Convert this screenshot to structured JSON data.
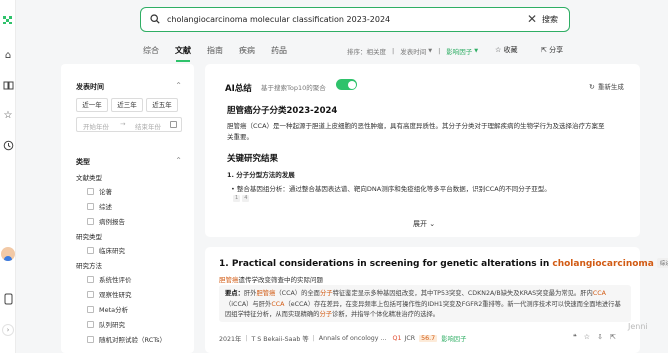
{
  "search": {
    "query": "cholangiocarcinoma molecular classification 2023-2024",
    "button": "搜索"
  },
  "tabs": [
    "综合",
    "文献",
    "指南",
    "疾病",
    "药品"
  ],
  "sort": {
    "label": "排序：",
    "options": [
      "相关度",
      "发表时间",
      "影响因子"
    ]
  },
  "header_actions": {
    "favorite": "收藏",
    "share": "分享"
  },
  "filters": {
    "time_title": "发表时间",
    "time_ranges": [
      "近一年",
      "近三年",
      "近五年"
    ],
    "date_start": "开始年份",
    "date_end": "结束年份",
    "type_title": "类型",
    "literature_type_title": "文献类型",
    "literature_types": [
      "论著",
      "综述",
      "病例报告"
    ],
    "study_type_title": "研究类型",
    "study_types": [
      "临床研究"
    ],
    "method_title": "研究方法",
    "methods": [
      "系统性评价",
      "观察性研究",
      "Meta分析",
      "队列研究",
      "随机对照试验（RCTs）"
    ]
  },
  "ai_summary": {
    "title": "AI总结",
    "note": "基于搜索Top10的聚合",
    "regenerate": "重新生成",
    "heading": "胆管癌分子分类2023-2024",
    "intro": "胆管癌（CCA）是一种起源于胆道上皮细胞的恶性肿瘤，具有高度异质性。其分子分类对于理解疾病的生物学行为及选择治疗方案至关重要。",
    "findings_title": "关键研究结果",
    "point_title": "1. 分子分型方法的发展",
    "point_text": "整合基因组分析：通过整合基因表达谱、靶向DNA测序和免疫组化等多平台数据，识别CCA的不同分子亚型。",
    "refs": [
      "1",
      "4"
    ],
    "expand": "展开"
  },
  "result": {
    "title_prefix": "1. Practical considerations in screening for genetic alterations in ",
    "title_highlight": "cholangiocarcinoma",
    "badge": "综述",
    "subtitle_highlight": "胆管癌",
    "subtitle_rest": "遗传学改变筛查中的实际问题",
    "abstract_label": "要点：",
    "abstract_pre": "肝外",
    "abstract_hl1": "胆管癌",
    "abstract_mid1": "（CCA）的全面",
    "abstract_hl2": "分子",
    "abstract_mid2": "特征鉴定显示多种基因组改变，其中TP53突变、CDKN2A/B缺失及KRAS突变最为常见。肝内",
    "abstract_hl3": "CCA",
    "abstract_mid3": "（iCCA）与肝外",
    "abstract_hl4": "CCA",
    "abstract_mid4": "（eCCA）存在差异，在变异频率上包括可操作性的IDH1突变及FGFR2重排等。新一代测序技术可以快速而全面地进行基因组学特征分析，从而实现精确的",
    "abstract_hl5": "分子",
    "abstract_end": "诊断，并指导个体化精准治疗的选择。",
    "year": "2021年",
    "authors": "T S Bekaii-Saab 等",
    "journal": "Annals of oncology ...",
    "quartile": "Q1",
    "jcr": "JCR",
    "impact": "56.7",
    "impact_label": "影响因子"
  },
  "watermark": "Jenni",
  "colors": {
    "accent": "#2fc26b",
    "highlight": "#d25b14"
  }
}
